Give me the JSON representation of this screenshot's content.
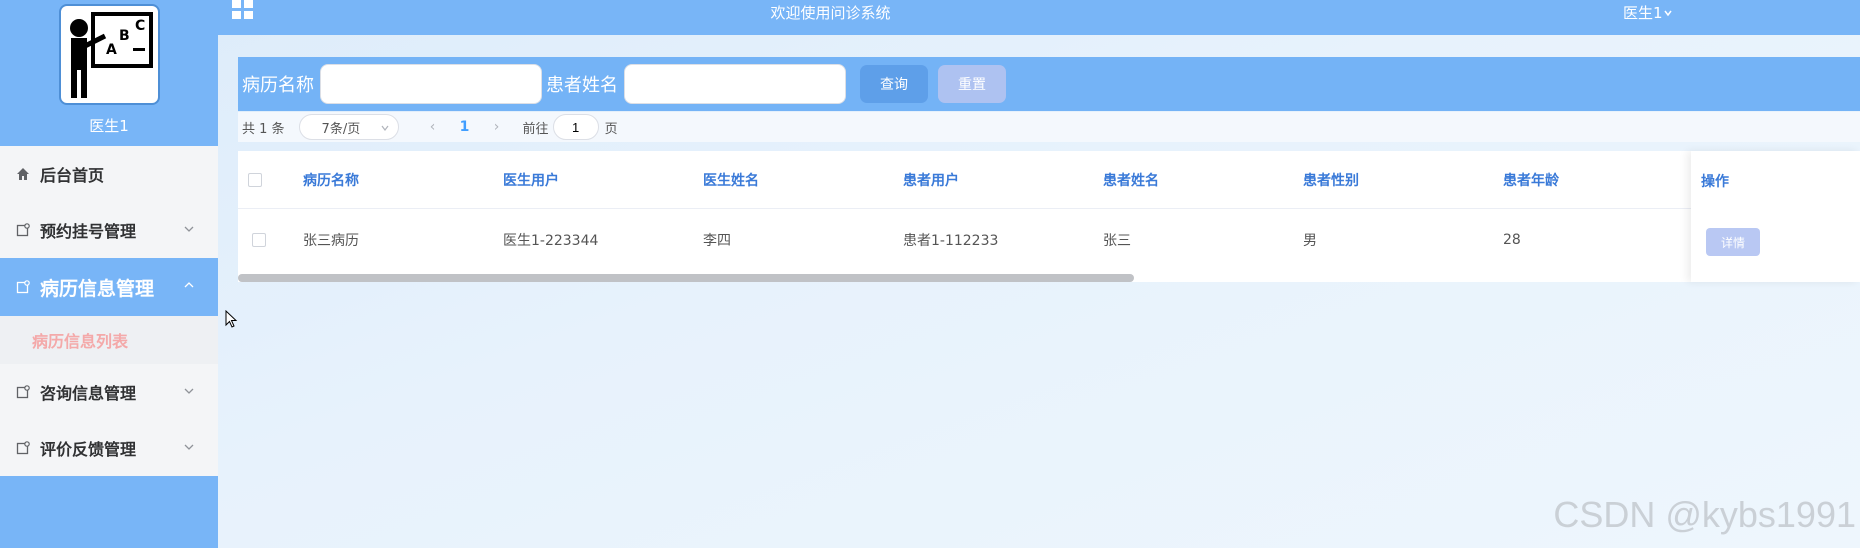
{
  "sidebar": {
    "doctor_name": "医生1",
    "menu": [
      {
        "label": "后台首页",
        "icon": "home-icon"
      },
      {
        "label": "预约挂号管理",
        "icon": "doc-icon"
      },
      {
        "label": "病历信息管理",
        "icon": "doc-icon",
        "active": true
      },
      {
        "label": "咨询信息管理",
        "icon": "doc-icon"
      },
      {
        "label": "评价反馈管理",
        "icon": "doc-icon"
      }
    ],
    "submenu_active": "病历信息列表"
  },
  "header": {
    "title": "欢迎使用问诊系统",
    "user": "医生1"
  },
  "search": {
    "record_name_label": "病历名称",
    "record_name_value": "",
    "patient_name_label": "患者姓名",
    "patient_name_value": "",
    "query_label": "查询",
    "reset_label": "重置"
  },
  "pager": {
    "total": "共 1 条",
    "page_size": "7条/页",
    "current_page": "1",
    "goto_label": "前往",
    "goto_value": "1",
    "page_unit": "页"
  },
  "table": {
    "columns": [
      "病历名称",
      "医生用户",
      "医生姓名",
      "患者用户",
      "患者姓名",
      "患者性别",
      "患者年龄"
    ],
    "op_header": "操作",
    "rows": [
      {
        "cells": [
          "张三病历",
          "医生1-223344",
          "李四",
          "患者1-112233",
          "张三",
          "男",
          "28"
        ],
        "action": "详情"
      }
    ]
  },
  "watermark": "CSDN @kybs1991",
  "colors": {
    "primary": "#78b5f7",
    "search_bar": "#74b3f6",
    "header_text_blue": "#3a7ad8",
    "active_submenu": "#f4a9a9"
  }
}
